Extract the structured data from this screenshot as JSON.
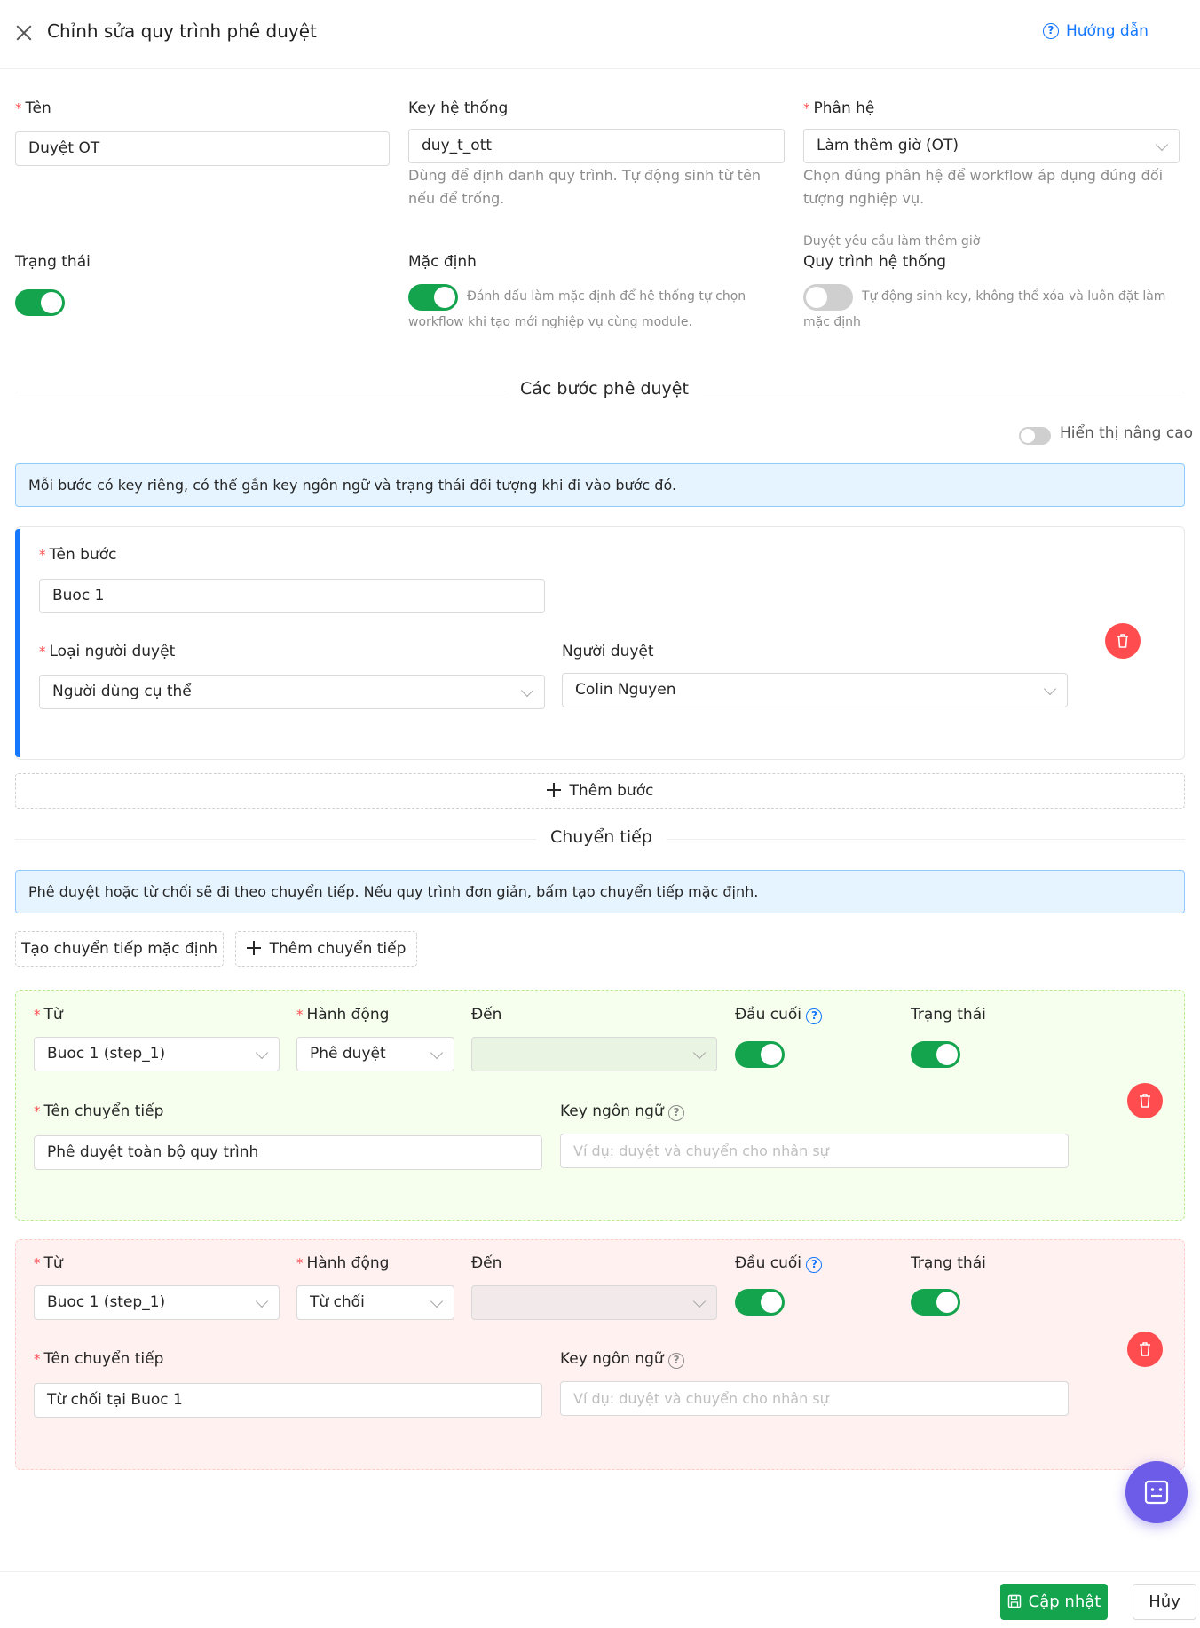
{
  "header": {
    "title": "Chỉnh sửa quy trình phê duyệt",
    "guide_label": "Hướng dẫn"
  },
  "form": {
    "name": {
      "label": "Tên",
      "value": "Duyệt OT"
    },
    "system_key": {
      "label": "Key hệ thống",
      "value": "duy_t_ott",
      "help": "Dùng để định danh quy trình. Tự động sinh từ tên nếu để trống."
    },
    "module": {
      "label": "Phân hệ",
      "value": "Làm thêm giờ (OT)",
      "help": "Chọn đúng phân hệ để workflow áp dụng đúng đối tượng nghiệp vụ.",
      "sub_note": "Duyệt yêu cầu làm thêm giờ"
    },
    "status": {
      "label": "Trạng thái",
      "on": true
    },
    "default": {
      "label": "Mặc định",
      "on": true,
      "help": "Đánh dấu làm mặc định để hệ thống tự chọn workflow khi tạo mới nghiệp vụ cùng module."
    },
    "system_flow": {
      "label": "Quy trình hệ thống",
      "on": false,
      "help": "Tự động sinh key, không thể xóa và luôn đặt làm mặc định"
    }
  },
  "steps_section": {
    "title": "Các bước phê duyệt",
    "advanced_label": "Hiển thị nâng cao",
    "info": "Mỗi bước có key riêng, có thể gắn key ngôn ngữ và trạng thái đối tượng khi đi vào bước đó.",
    "step": {
      "name_label": "Tên bước",
      "name_value": "Buoc 1",
      "approver_type_label": "Loại người duyệt",
      "approver_type_value": "Người dùng cụ thể",
      "approver_label": "Người duyệt",
      "approver_value": "Colin Nguyen"
    },
    "add_step_label": "Thêm bước"
  },
  "transitions_section": {
    "title": "Chuyển tiếp",
    "info": "Phê duyệt hoặc từ chối sẽ đi theo chuyển tiếp. Nếu quy trình đơn giản, bấm tạo chuyển tiếp mặc định.",
    "create_default_label": "Tạo chuyển tiếp mặc định",
    "add_transition_label": "Thêm chuyển tiếp",
    "field_labels": {
      "from": "Từ",
      "action": "Hành động",
      "to": "Đến",
      "terminal": "Đầu cuối",
      "status": "Trạng thái",
      "name": "Tên chuyển tiếp",
      "lang_key": "Key ngôn ngữ"
    },
    "lang_placeholder": "Ví dụ: duyệt và chuyển cho nhân sự",
    "items": [
      {
        "from": "Buoc 1 (step_1)",
        "action": "Phê duyệt",
        "to": "",
        "terminal": true,
        "status": true,
        "name": "Phê duyệt toàn bộ quy trình",
        "lang_key": "",
        "color": "#f6ffed"
      },
      {
        "from": "Buoc 1 (step_1)",
        "action": "Từ chối",
        "to": "",
        "terminal": true,
        "status": true,
        "name": "Từ chối tại Buoc 1",
        "lang_key": "",
        "color": "#fff1f0"
      }
    ]
  },
  "footer": {
    "update_label": "Cập nhật",
    "cancel_label": "Hủy"
  },
  "colors": {
    "primary": "#14a44d",
    "link": "#1677ff",
    "danger": "#ff4d4f",
    "fab": "#6c5ce7"
  }
}
